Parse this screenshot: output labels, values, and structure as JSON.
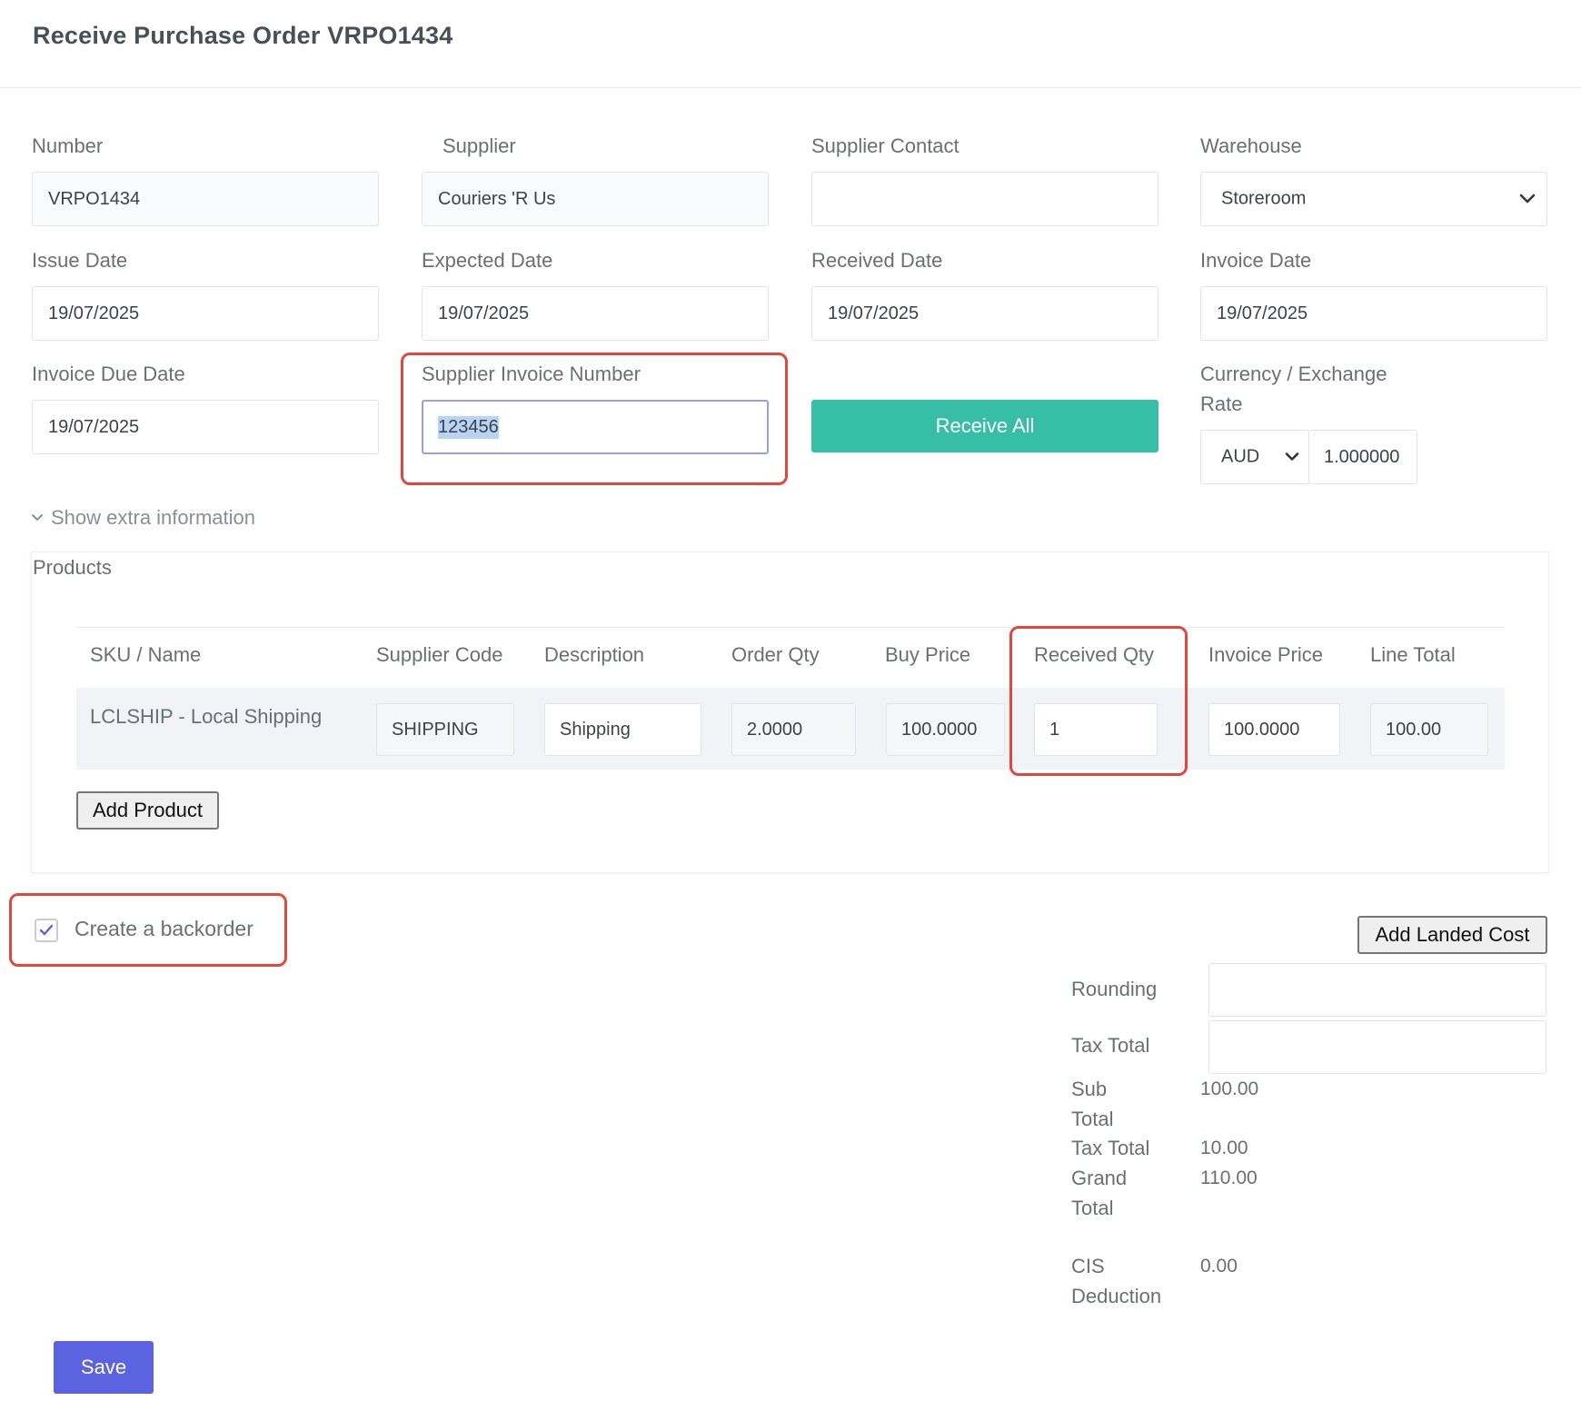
{
  "page": {
    "title": "Receive Purchase Order VRPO1434"
  },
  "fields": {
    "number": {
      "label": "Number",
      "value": "VRPO1434"
    },
    "supplier": {
      "label": "Supplier",
      "value": "Couriers 'R Us"
    },
    "supplier_contact": {
      "label": "Supplier Contact",
      "value": ""
    },
    "warehouse": {
      "label": "Warehouse",
      "value": "Storeroom"
    },
    "issue_date": {
      "label": "Issue Date",
      "value": "19/07/2025"
    },
    "expected_date": {
      "label": "Expected Date",
      "value": "19/07/2025"
    },
    "received_date": {
      "label": "Received Date",
      "value": "19/07/2025"
    },
    "invoice_date": {
      "label": "Invoice Date",
      "value": "19/07/2025"
    },
    "invoice_due_date": {
      "label": "Invoice Due Date",
      "value": "19/07/2025"
    },
    "supplier_invoice_number": {
      "label": "Supplier Invoice Number",
      "value": "123456"
    },
    "currency": {
      "label_line1": "Currency / Exchange",
      "label_line2": "Rate",
      "value": "AUD",
      "rate": "1.000000"
    }
  },
  "buttons": {
    "receive_all": "Receive All",
    "add_product": "Add Product",
    "add_landed_cost": "Add Landed Cost",
    "save": "Save"
  },
  "extra_info_toggle": "Show extra information",
  "products": {
    "title": "Products",
    "columns": [
      "SKU / Name",
      "Supplier Code",
      "Description",
      "Order Qty",
      "Buy Price",
      "Received Qty",
      "Invoice Price",
      "Line Total"
    ],
    "rows": [
      {
        "sku_name": "LCLSHIP - Local Shipping",
        "supplier_code": "SHIPPING",
        "description": "Shipping",
        "order_qty": "2.0000",
        "buy_price": "100.0000",
        "received_qty": "1",
        "invoice_price": "100.0000",
        "line_total": "100.00"
      }
    ]
  },
  "backorder": {
    "label": "Create a backorder",
    "checked": true
  },
  "summary": {
    "rounding_label": "Rounding",
    "rounding_value": "",
    "tax_total_input_label": "Tax Total",
    "tax_total_input_value": "",
    "sub_total_label_1": "Sub",
    "sub_total_label_2": "Total",
    "sub_total_value": "100.00",
    "tax_total_label": "Tax Total",
    "tax_total_value": "10.00",
    "grand_total_label_1": "Grand",
    "grand_total_label_2": "Total",
    "grand_total_value": "110.00",
    "cis_label_1": "CIS",
    "cis_label_2": "Deduction",
    "cis_value": "0.00"
  },
  "colors": {
    "accent_teal": "#36bfa6",
    "save_blue": "#5b63e0",
    "highlight_red": "#e0483e"
  },
  "icons": [
    "chevron-down-icon",
    "check-icon"
  ]
}
